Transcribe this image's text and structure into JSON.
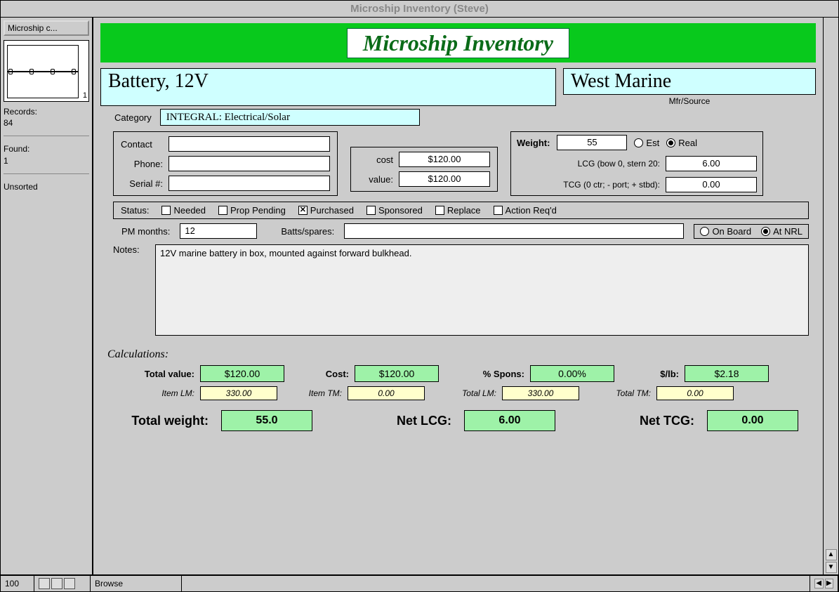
{
  "window": {
    "title": "Microship Inventory (Steve)"
  },
  "sidebar": {
    "mode_button": "Microship c...",
    "rolodex_index": "1",
    "records_label": "Records:",
    "records_count": "84",
    "found_label": "Found:",
    "found_count": "1",
    "sort_state": "Unsorted"
  },
  "banner": {
    "title": "Microship Inventory"
  },
  "item": {
    "name": "Battery, 12V",
    "mfr": "West Marine",
    "mfr_label": "Mfr/Source",
    "category_label": "Category",
    "category": "INTEGRAL: Electrical/Solar"
  },
  "contact": {
    "contact_label": "Contact",
    "phone_label": "Phone:",
    "serial_label": "Serial #:",
    "contact": "",
    "phone": "",
    "serial": ""
  },
  "money": {
    "cost_label": "cost",
    "value_label": "value:",
    "cost": "$120.00",
    "value": "$120.00"
  },
  "weight": {
    "label": "Weight:",
    "value": "55",
    "est_label": "Est",
    "real_label": "Real",
    "selected": "Real",
    "lcg_label": "LCG (bow 0, stern 20:",
    "lcg": "6.00",
    "tcg_label": "TCG (0 ctr; - port; + stbd):",
    "tcg": "0.00"
  },
  "status": {
    "label": "Status:",
    "options": [
      "Needed",
      "Prop Pending",
      "Purchased",
      "Sponsored",
      "Replace",
      "Action Req'd"
    ],
    "checked": [
      "Purchased"
    ]
  },
  "pm": {
    "label": "PM months:",
    "value": "12",
    "batts_label": "Batts/spares:",
    "batts": "",
    "loc_opts": [
      "On Board",
      "At NRL"
    ],
    "loc_selected": "At NRL"
  },
  "notes": {
    "label": "Notes:",
    "text": "12V marine battery in box, mounted against forward bulkhead."
  },
  "calc": {
    "heading": "Calculations:",
    "total_value_label": "Total value:",
    "total_value": "$120.00",
    "cost_label": "Cost:",
    "cost": "$120.00",
    "pct_spons_label": "% Spons:",
    "pct_spons": "0.00%",
    "per_lb_label": "$/lb:",
    "per_lb": "$2.18",
    "item_lm_label": "Item LM:",
    "item_lm": "330.00",
    "item_tm_label": "Item TM:",
    "item_tm": "0.00",
    "total_lm_label": "Total LM:",
    "total_lm": "330.00",
    "total_tm_label": "Total TM:",
    "total_tm": "0.00",
    "total_weight_label": "Total weight:",
    "total_weight": "55.0",
    "net_lcg_label": "Net LCG:",
    "net_lcg": "6.00",
    "net_tcg_label": "Net TCG:",
    "net_tcg": "0.00"
  },
  "statusbar": {
    "zoom": "100",
    "mode": "Browse"
  }
}
